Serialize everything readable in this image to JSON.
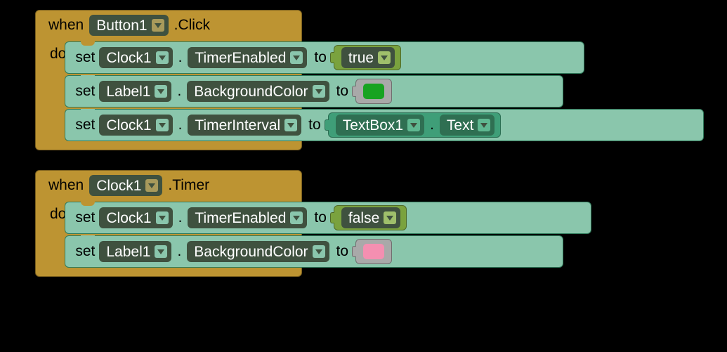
{
  "kw": {
    "when": "when",
    "do": "do",
    "set": "set",
    "to": "to"
  },
  "block1": {
    "component": "Button1",
    "event": ".Click",
    "stmts": [
      {
        "comp": "Clock1",
        "prop": "TimerEnabled",
        "val_type": "bool",
        "val": "true"
      },
      {
        "comp": "Label1",
        "prop": "BackgroundColor",
        "val_type": "color",
        "color": "#18a321"
      },
      {
        "comp": "Clock1",
        "prop": "TimerInterval",
        "val_type": "get",
        "get_comp": "TextBox1",
        "get_prop": "Text"
      }
    ]
  },
  "block2": {
    "component": "Clock1",
    "event": ".Timer",
    "stmts": [
      {
        "comp": "Clock1",
        "prop": "TimerEnabled",
        "val_type": "bool",
        "val": "false"
      },
      {
        "comp": "Label1",
        "prop": "BackgroundColor",
        "val_type": "color",
        "color": "#f48fb1"
      }
    ]
  }
}
